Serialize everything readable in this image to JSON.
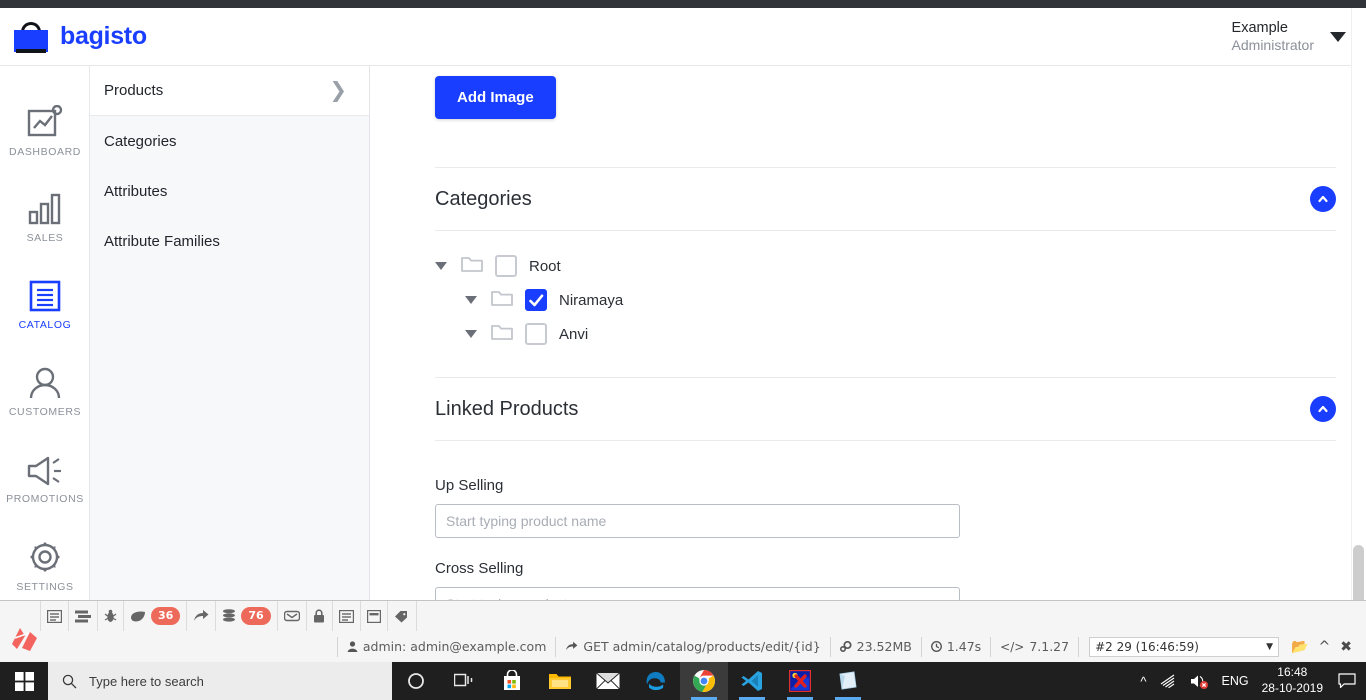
{
  "header": {
    "brand": "bagisto",
    "brand_color": "#1a3eff",
    "user_name": "Example",
    "user_role": "Administrator"
  },
  "icon_sidebar": {
    "items": [
      {
        "label": "DASHBOARD",
        "icon": "dashboard-icon",
        "active": false
      },
      {
        "label": "SALES",
        "icon": "sales-bars-icon",
        "active": false
      },
      {
        "label": "CATALOG",
        "icon": "catalog-document-icon",
        "active": true
      },
      {
        "label": "CUSTOMERS",
        "icon": "user-icon",
        "active": false
      },
      {
        "label": "PROMOTIONS",
        "icon": "megaphone-icon",
        "active": false
      },
      {
        "label": "SETTINGS",
        "icon": "gear-icon",
        "active": false
      }
    ]
  },
  "submenu": {
    "items": [
      {
        "label": "Products",
        "current": true,
        "chevron": "chevron-right-icon"
      },
      {
        "label": "Categories",
        "current": false
      },
      {
        "label": "Attributes",
        "current": false
      },
      {
        "label": "Attribute Families",
        "current": false
      }
    ]
  },
  "main": {
    "add_image_button": "Add Image",
    "categories_section": {
      "title": "Categories",
      "collapse_icon": "chevron-up-icon",
      "tree": [
        {
          "label": "Root",
          "level": 1,
          "checked": false,
          "expanded": true
        },
        {
          "label": "Niramaya",
          "level": 2,
          "checked": true,
          "expanded": true
        },
        {
          "label": "Anvi",
          "level": 2,
          "checked": false,
          "expanded": true
        }
      ]
    },
    "linked_products_section": {
      "title": "Linked Products",
      "collapse_icon": "chevron-up-icon",
      "fields": [
        {
          "label": "Up Selling",
          "value": "",
          "placeholder": "Start typing product name"
        },
        {
          "label": "Cross Selling",
          "value": "",
          "placeholder": "Start typing product name"
        }
      ]
    }
  },
  "debugbar": {
    "tabs": [
      {
        "name": "messages",
        "icon": "message-list-icon",
        "badge": ""
      },
      {
        "name": "timeline",
        "icon": "timeline-icon",
        "badge": ""
      },
      {
        "name": "exceptions",
        "icon": "bug-icon",
        "badge": ""
      },
      {
        "name": "views",
        "icon": "leaf-icon",
        "badge": "36"
      },
      {
        "name": "route",
        "icon": "arrow-share-icon",
        "badge": ""
      },
      {
        "name": "queries",
        "icon": "database-icon",
        "badge": "76"
      },
      {
        "name": "mail",
        "icon": "envelope-icon",
        "badge": ""
      },
      {
        "name": "auth",
        "icon": "lock-icon",
        "badge": ""
      },
      {
        "name": "session",
        "icon": "session-icon",
        "badge": ""
      },
      {
        "name": "gate",
        "icon": "archive-icon",
        "badge": ""
      },
      {
        "name": "tags",
        "icon": "tag-icon",
        "badge": ""
      }
    ],
    "stats": [
      {
        "icon": "user-icon",
        "text": "admin: admin@example.com"
      },
      {
        "icon": "arrow-share-icon",
        "text": "GET admin/catalog/products/edit/{id}"
      },
      {
        "icon": "gears-icon",
        "text": "23.52MB"
      },
      {
        "icon": "clock-icon",
        "text": "1.47s"
      },
      {
        "icon": "code-icon",
        "text": "7.1.27"
      }
    ],
    "request_select": "#2 29 (16:46:59)",
    "actions": [
      {
        "name": "open-folder",
        "icon": "folder-icon"
      },
      {
        "name": "minimize",
        "icon": "chevron-up-icon"
      },
      {
        "name": "close",
        "icon": "close-icon"
      }
    ]
  },
  "taskbar": {
    "start_icon": "windows-start-icon",
    "search_placeholder": "Type here to search",
    "search_icon": "search-icon",
    "icons": [
      {
        "name": "task-view-icon",
        "active": false,
        "running": false
      },
      {
        "name": "microsoft-store-icon",
        "active": false,
        "running": false
      },
      {
        "name": "file-explorer-icon",
        "active": false,
        "running": false
      },
      {
        "name": "mail-icon",
        "active": false,
        "running": false
      },
      {
        "name": "edge-icon",
        "active": false,
        "running": false
      },
      {
        "name": "chrome-icon",
        "active": true,
        "running": true
      },
      {
        "name": "vscode-icon",
        "active": false,
        "running": true
      },
      {
        "name": "xara-icon",
        "active": false,
        "running": true
      },
      {
        "name": "sticky-notes-icon",
        "active": false,
        "running": true
      }
    ],
    "tray": {
      "overflow_icon": "chevron-up-icon",
      "network_icon": "wifi-icon",
      "volume_icon": "speaker-muted-icon",
      "language": "ENG",
      "time": "16:48",
      "date": "28-10-2019",
      "notification_icon": "notification-icon"
    }
  }
}
